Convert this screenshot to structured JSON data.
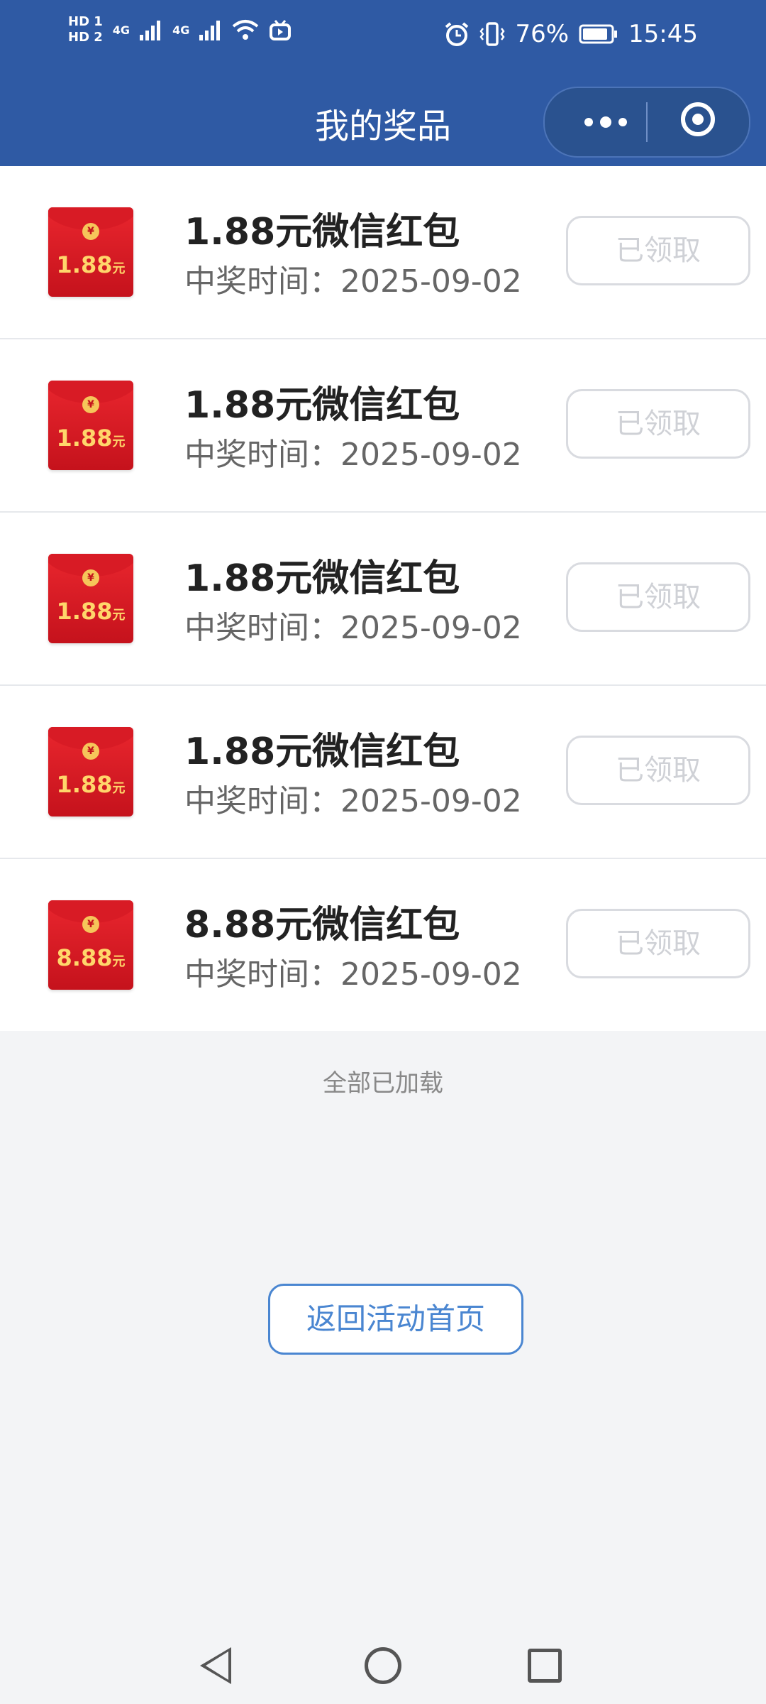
{
  "status_bar": {
    "sim1": "HD 1",
    "sim2": "HD 2",
    "net1": "4G",
    "net2": "4G",
    "battery": "76%",
    "time": "15:45"
  },
  "header": {
    "title": "我的奖品"
  },
  "prizes": [
    {
      "title": "1.88元微信红包",
      "date": "中奖时间：2025-09-02",
      "amount": "1.88",
      "unit": "元",
      "button": "已领取"
    },
    {
      "title": "1.88元微信红包",
      "date": "中奖时间：2025-09-02",
      "amount": "1.88",
      "unit": "元",
      "button": "已领取"
    },
    {
      "title": "1.88元微信红包",
      "date": "中奖时间：2025-09-02",
      "amount": "1.88",
      "unit": "元",
      "button": "已领取"
    },
    {
      "title": "1.88元微信红包",
      "date": "中奖时间：2025-09-02",
      "amount": "1.88",
      "unit": "元",
      "button": "已领取"
    },
    {
      "title": "8.88元微信红包",
      "date": "中奖时间：2025-09-02",
      "amount": "8.88",
      "unit": "元",
      "button": "已领取"
    }
  ],
  "list_footer": "全部已加载",
  "back_button": "返回活动首页",
  "colors": {
    "header_bg": "#2f5aa4",
    "accent": "#4a86d1",
    "envelope_red": "#e9262e"
  }
}
